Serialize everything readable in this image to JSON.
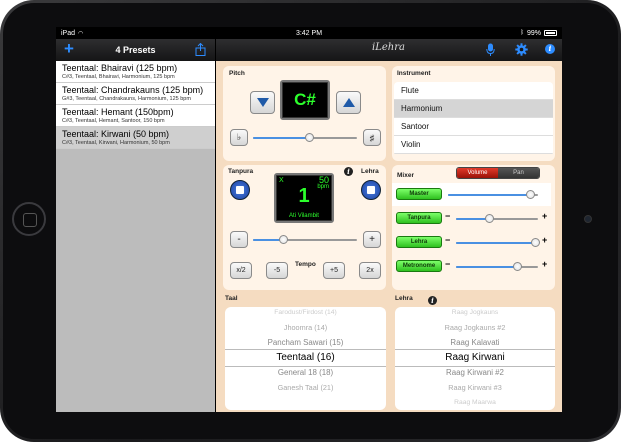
{
  "status": {
    "carrier": "iPad",
    "time": "3:42 PM",
    "battery": "99%"
  },
  "sidebar": {
    "title": "4 Presets",
    "presets": [
      {
        "title": "Teentaal: Bhairavi (125 bpm)",
        "sub": "C#3, Teentaal, Bhairavi, Harmonium, 125 bpm"
      },
      {
        "title": "Teentaal: Chandrakauns (125 bpm)",
        "sub": "G#3, Teentaal, Chandrakauns, Harmonium, 125 bpm"
      },
      {
        "title": "Teentaal: Hemant (150bpm)",
        "sub": "C#3, Teentaal, Hemant, Santoor, 150 bpm"
      },
      {
        "title": "Teentaal: Kirwani (50 bpm)",
        "sub": "C#3, Teentaal, Kirwani, Harmonium, 50 bpm"
      }
    ]
  },
  "header": {
    "logo": "iLehra"
  },
  "pitch": {
    "label": "Pitch",
    "note": "C#",
    "flat": "♭",
    "sharp": "♯",
    "slider_value": 0.55
  },
  "instrument": {
    "label": "Instrument",
    "items": [
      "Flute",
      "Harmonium",
      "Santoor",
      "Violin"
    ],
    "selected": 1
  },
  "tanpura": {
    "label": "Tanpura"
  },
  "lehra": {
    "label": "Lehra"
  },
  "tempo_display": {
    "x": "X",
    "bpm_value": "50",
    "bpm_unit": "bpm",
    "count": "1",
    "laya": "Ati Vilambit"
  },
  "tempo": {
    "label": "Tempo",
    "minus": "-",
    "plus": "+",
    "half": "x/2",
    "m5": "-5",
    "p5": "+5",
    "double": "2x",
    "slider_value": 0.3
  },
  "mixer": {
    "label": "Mixer",
    "mode_volume": "Volume",
    "mode_pan": "Pan",
    "channels": [
      {
        "name": "Master",
        "value": 0.92
      },
      {
        "name": "Tanpura",
        "value": 0.42
      },
      {
        "name": "Lehra",
        "value": 0.98
      },
      {
        "name": "Metronome",
        "value": 0.75
      }
    ],
    "minus": "−",
    "plus": "+"
  },
  "taal": {
    "label": "Taal",
    "items": [
      "Farodust/Firdost (14)",
      "Jhoomra (14)",
      "Pancham Sawari (15)",
      "Teentaal (16)",
      "General 18 (18)",
      "Ganesh Taal (21)"
    ],
    "selected": 3
  },
  "lehra_list": {
    "label": "Lehra",
    "items": [
      "Raag Jogkauns",
      "Raag Jogkauns #2",
      "Raag Kalavati",
      "Raag Kirwani",
      "Raag Kirwani #2",
      "Raag Kirwani #3",
      "Raag Maarwa"
    ],
    "selected": 3
  },
  "colors": {
    "accent": "#2d8cff",
    "panel_bg": "#f5dcc1",
    "lcd_green": "#2cff2c",
    "mixer_green": "#3bd22a"
  }
}
